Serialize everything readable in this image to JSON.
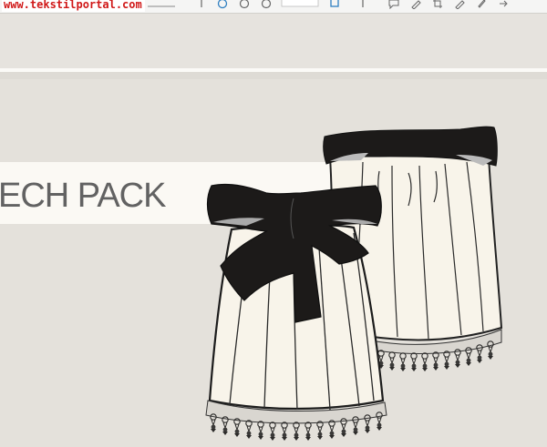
{
  "watermark": {
    "text": "www.tekstilportal.com"
  },
  "toolbar": {
    "icons": [
      "close-icon",
      "dots-icon",
      "lasso-icon",
      "refresh-icon",
      "clock-icon",
      "dropdown-icon",
      "frame-icon",
      "arrows-icon",
      "chat-icon",
      "pen-icon",
      "crop-icon",
      "edit-icon",
      "brush-icon",
      "share-icon"
    ]
  },
  "banner": {
    "title": "ECH PACK"
  },
  "colors": {
    "background": "#e4e1db",
    "banner": "#fbf9f4",
    "fabric": "#f8f4ea",
    "bow": "#1c1a19",
    "watermark": "#d01818"
  }
}
